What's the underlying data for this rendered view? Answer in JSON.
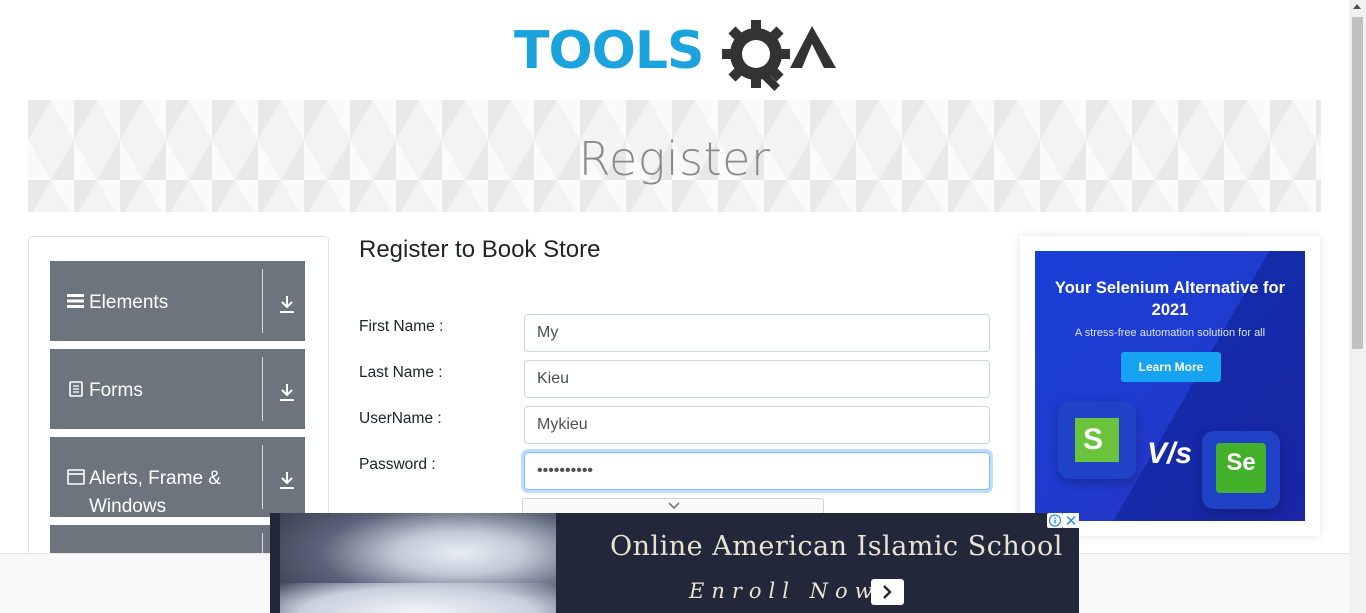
{
  "header": {
    "logo_text": "TOOLSQA",
    "logo_alt": "ToolsQA logo"
  },
  "banner": {
    "title": "Register"
  },
  "sidebar": {
    "groups": [
      {
        "label": "Elements",
        "icon": "hamburger-icon"
      },
      {
        "label": "Forms",
        "icon": "document-icon"
      },
      {
        "label": "Alerts, Frame & Windows",
        "icon": "window-icon"
      },
      {
        "label": "",
        "icon": ""
      }
    ]
  },
  "form": {
    "title": "Register to Book Store",
    "fields": [
      {
        "label": "First Name :",
        "value": "My"
      },
      {
        "label": "Last Name :",
        "value": "Kieu"
      },
      {
        "label": "UserName :",
        "value": "Mykieu"
      },
      {
        "label": "Password :",
        "value": "••••••••••"
      }
    ]
  },
  "right_ad": {
    "title": "Your Selenium Alternative for 2021",
    "subtitle": "A stress-free automation solution for all",
    "button": "Learn More",
    "left_logo": "S",
    "versus": "V/s",
    "right_logo": "Se",
    "accent": "#16a3f2",
    "background": "#1a3fd6"
  },
  "bottom_ad": {
    "headline": "Online American Islamic School",
    "cta": "Enroll Now",
    "info_icon": "info-icon",
    "close_icon": "close-icon"
  },
  "colors": {
    "sidebar_bg": "#6c757d",
    "logo_blue": "#1aa3dc",
    "logo_dark": "#333333"
  }
}
